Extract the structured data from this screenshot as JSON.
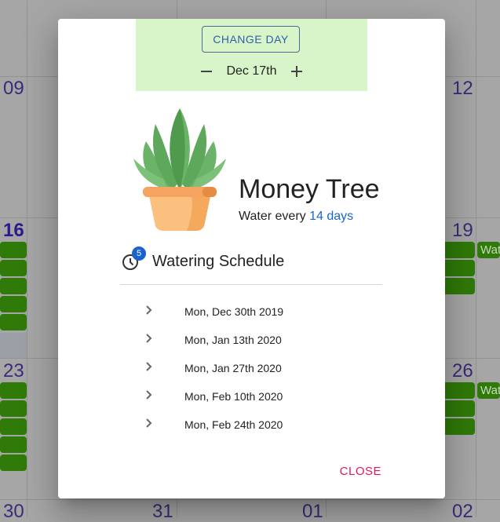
{
  "calendar": {
    "day_numbers": [
      "09",
      "12",
      "16",
      "19",
      "23",
      "26",
      "30",
      "31",
      "01",
      "02"
    ],
    "event_labels": [
      "Wat",
      "Wat"
    ]
  },
  "dialog": {
    "change_day_label": "CHANGE DAY",
    "date_label": "Dec 17th",
    "minus_icon": "minus-icon",
    "plus_icon": "plus-icon",
    "plant": {
      "name": "Money Tree",
      "water_prefix": "Water every",
      "water_interval": "14 days"
    },
    "schedule": {
      "title": "Watering Schedule",
      "badge": "5",
      "icon": "clock-icon",
      "items": [
        {
          "date": "Mon, Dec 30th 2019"
        },
        {
          "date": "Mon, Jan 13th 2020"
        },
        {
          "date": "Mon, Jan 27th 2020"
        },
        {
          "date": "Mon, Feb 10th 2020"
        },
        {
          "date": "Mon, Feb 24th 2020"
        }
      ]
    },
    "close_label": "CLOSE"
  },
  "colors": {
    "accent": "#e0175e",
    "link": "#1a66c9",
    "day_box": "#d7f5c8",
    "event_chip": "#2f7a08"
  }
}
